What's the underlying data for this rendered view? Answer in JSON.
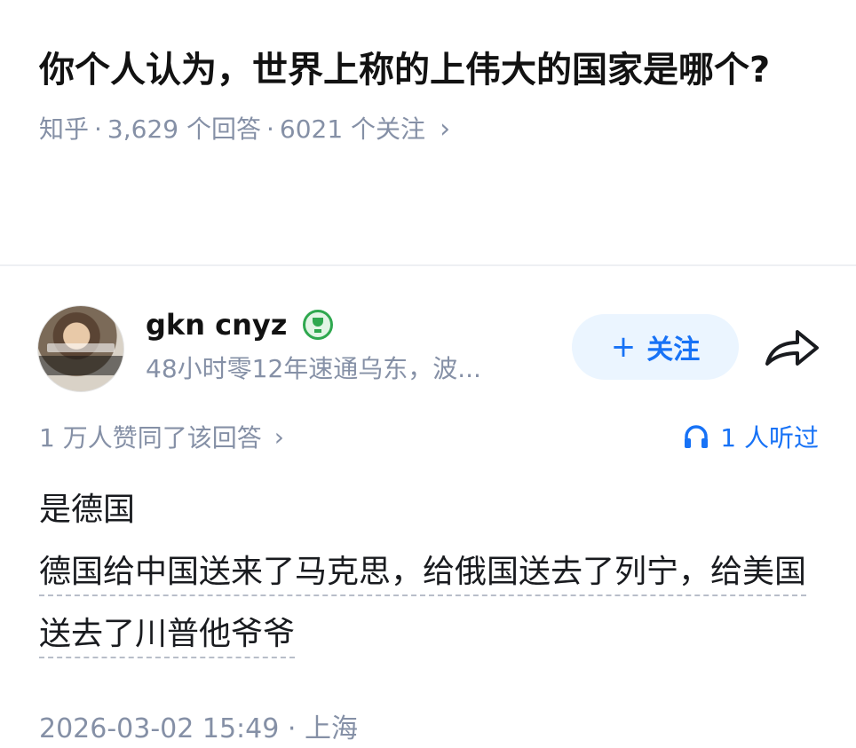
{
  "question": {
    "title": "你个人认为，世界上称的上伟大的国家是哪个?",
    "source": "知乎",
    "answers": "3,629 个回答",
    "followers": "6021 个关注",
    "chevron": "›",
    "separator": "·"
  },
  "author": {
    "name": "gkn cnyz",
    "badge_icon": "trophy-badge-icon",
    "description": "48小时零12年速通乌东，波...",
    "follow_label": "关注",
    "follow_plus": "+",
    "share_icon": "share-icon"
  },
  "stats": {
    "agree_text": "1 万人赞同了该回答",
    "agree_chevron": "›",
    "listen_icon": "headphone-icon",
    "listen_text": "1 人听过"
  },
  "answer": {
    "line1": "是德国",
    "line2": "德国给中国送来了马克思，给俄国送去了列宁，给美国送去了川普他爷爷"
  },
  "footer": {
    "timestamp": "2026-03-02 15:49",
    "separator": "·",
    "location": "上海"
  },
  "colors": {
    "accent": "#1772f6",
    "muted": "#8590a6",
    "follow_bg": "#ebf5ff",
    "badge_green": "#2fa84f"
  }
}
